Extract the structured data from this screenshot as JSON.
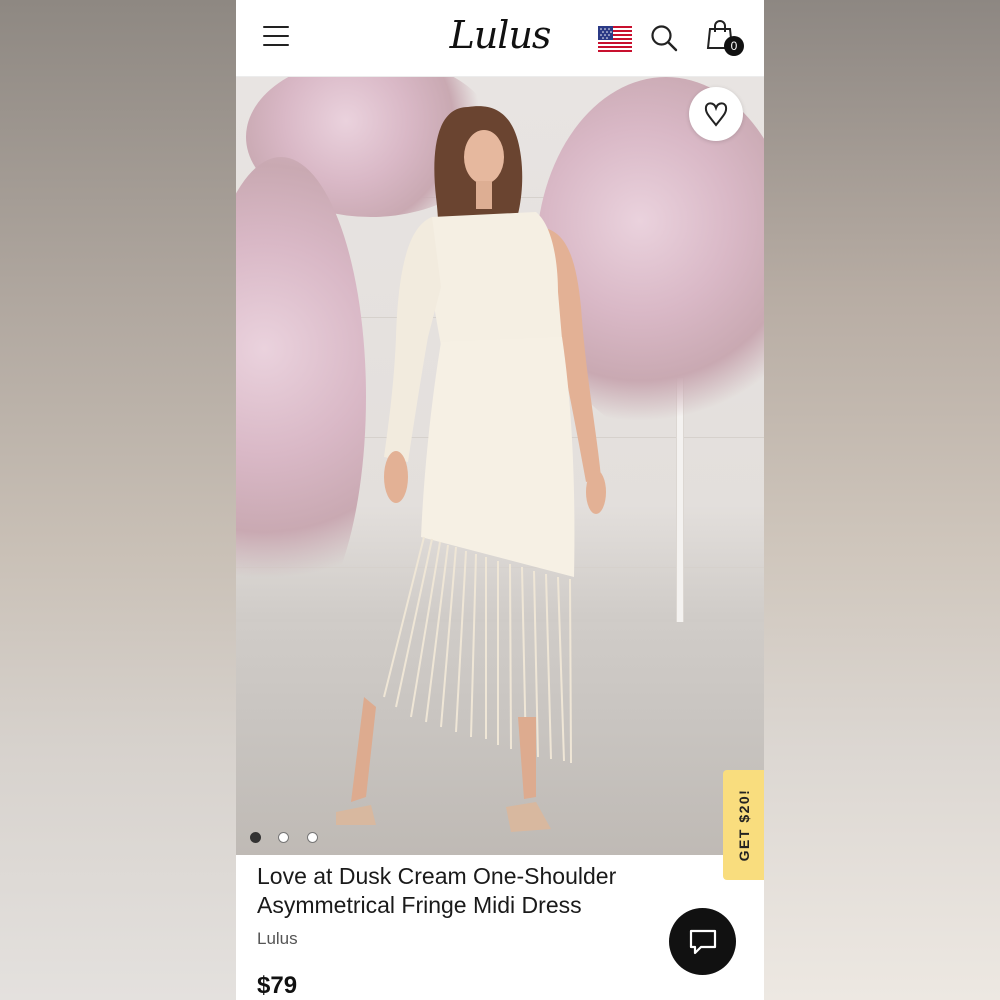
{
  "header": {
    "logo_text": "Lulus",
    "menu_icon": "hamburger-menu-icon",
    "flag_icon": "us-flag-icon",
    "search_icon": "search-icon",
    "bag_icon": "shopping-bag-icon",
    "bag_count": "0"
  },
  "gallery": {
    "wishlist_icon": "heart-icon",
    "image_count": 3,
    "active_index": 0
  },
  "promo": {
    "label": "GET $20!",
    "color": "#f9dd7e"
  },
  "product": {
    "title": "Love at Dusk Cream One-Shoulder Asymmetrical Fringe Midi Dress",
    "brand": "Lulus",
    "price": "$79"
  },
  "chat": {
    "icon": "chat-bubble-icon"
  }
}
